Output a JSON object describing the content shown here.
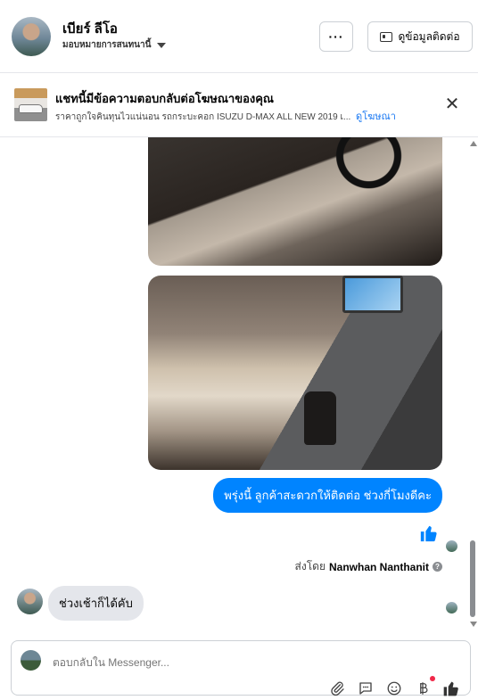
{
  "header": {
    "name": "เบียร์ ลีโอ",
    "assign_label": "มอบหมายการสนทนานี้",
    "more_label": "···",
    "contact_label": "ดูข้อมูลติดต่อ"
  },
  "ad_banner": {
    "title": "แชทนี้มีข้อความตอบกลับต่อโฆษณาของคุณ",
    "subtitle": "ราคาถูกใจคินทุนไวแน่นอน รถกระบะคอก ISUZU D-MAX ALL NEW 2019 เ...",
    "link": "ดูโฆษณา",
    "close": "✕"
  },
  "messages": {
    "outgoing_text": "พรุ่งนี้ ลูกค้าสะดวกให้ติดต่อ ช่วงกี่โมงดีคะ",
    "sent_by_prefix": "ส่งโดย",
    "sent_by_name": "Nanwhan Nanthanit",
    "sent_by_info": "?",
    "incoming_text": "ช่วงเช้าก็ได้คับ"
  },
  "composer": {
    "placeholder": "ตอบกลับใน Messenger..."
  },
  "colors": {
    "accent": "#0084ff",
    "link": "#1877f2",
    "bubble_in": "#e4e6eb",
    "notify": "#f02849"
  },
  "icons": {
    "attach": "paperclip-icon",
    "saved_replies": "chat-bubble-icon",
    "emoji": "smiley-icon",
    "payment": "baht-icon",
    "like": "thumbs-up-icon"
  }
}
